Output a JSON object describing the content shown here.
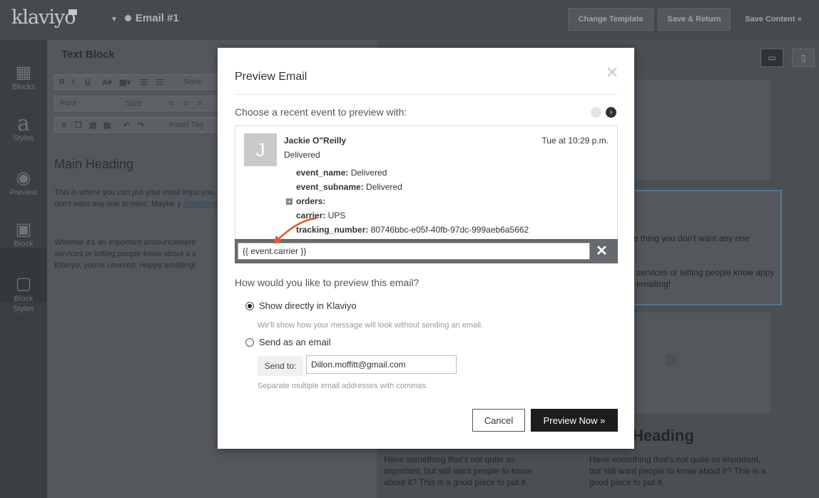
{
  "app": {
    "logo": "klaviyo",
    "email_name": "Email #1"
  },
  "topbar": {
    "change_template": "Change Template",
    "save_return": "Save & Return",
    "save_content": "Save Content »"
  },
  "rail": [
    {
      "label": "Blocks",
      "icon": "blocks-icon"
    },
    {
      "label": "Styles",
      "icon": "styles-icon"
    },
    {
      "label": "Preview",
      "icon": "eye-icon"
    },
    {
      "label": "Block",
      "icon": "block-icon"
    },
    {
      "label": "Block Styles",
      "icon": "block-styles-icon"
    }
  ],
  "editor": {
    "title": "Text Block",
    "font": "Font",
    "size": "Size",
    "insert_tag": "Insert Tag",
    "normal": "Norm",
    "heading": "Main Heading",
    "para1": "This is where you can put your most impo you don't want any one to miss. Maybe y",
    "para1_link": "something.",
    "para2": "Whether it's an important announcement services or letting people know about a s Klaviyo, you're covered. Happy emailing!"
  },
  "canvas": {
    "text1": "e thing you don't want any one",
    "text2": "services or letting people know appy emailing!",
    "heading": "Heading",
    "col1": "Have something that's not quite as important, but still want people to know about it? This is a good place to put it.",
    "col2": "Have something that's not quite as important, but still want people to know about it? This is a good place to put it."
  },
  "modal": {
    "title": "Preview Email",
    "choose_label": "Choose a recent event to preview with:",
    "event": {
      "avatar_letter": "J",
      "name": "Jackie O\"Reilly",
      "status": "Delivered",
      "time": "Tue at 10:29 p.m.",
      "props": [
        {
          "key": "event_name:",
          "value": "Delivered"
        },
        {
          "key": "event_subname:",
          "value": "Delivered"
        },
        {
          "key": "orders:",
          "value": ""
        },
        {
          "key": "carrier:",
          "value": "UPS"
        },
        {
          "key": "tracking_number:",
          "value": "80746bbc-e05f-40fb-97dc-999aeb6a5662"
        }
      ]
    },
    "variable_value": "{{ event.carrier }}",
    "question": "How would you like to preview this email?",
    "option_direct": "Show directly in Klaviyo",
    "option_direct_hint": "We'll show how your message will look without sending an email.",
    "option_send": "Send as an email",
    "send_to_label": "Send to:",
    "send_to_value": "Dillon.moffitt@gmail.com",
    "send_to_hint": "Separate multiple email addresses with commas.",
    "cancel": "Cancel",
    "preview_now": "Preview Now »"
  }
}
